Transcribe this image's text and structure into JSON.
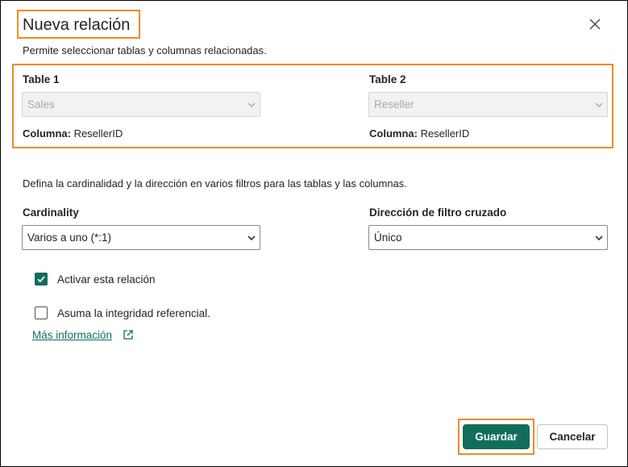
{
  "dialog": {
    "title": "Nueva relación",
    "subtitle": "Permite seleccionar tablas y columnas relacionadas."
  },
  "table1": {
    "label": "Table 1",
    "value": "Sales",
    "column_label": "Columna:",
    "column_value": " ResellerID"
  },
  "table2": {
    "label": "Table 2",
    "value": "Reseller",
    "column_label": "Columna:",
    "column_value": " ResellerID"
  },
  "cardinality_desc": "Defina la cardinalidad y la dirección en varios filtros para las tablas y las columnas.",
  "cardinality": {
    "label": "Cardinality",
    "value": "Varios a uno (*:1)"
  },
  "cross_filter": {
    "label": "Dirección de filtro cruzado",
    "value": "Único"
  },
  "options": {
    "activate": {
      "label": "Activar esta relación",
      "checked": true
    },
    "integrity": {
      "label": "Asuma la integridad referencial.",
      "checked": false
    }
  },
  "more_info": "Más información",
  "buttons": {
    "save": "Guardar",
    "cancel": "Cancelar"
  },
  "colors": {
    "accent": "#116e5c",
    "highlight": "#f08a24"
  }
}
